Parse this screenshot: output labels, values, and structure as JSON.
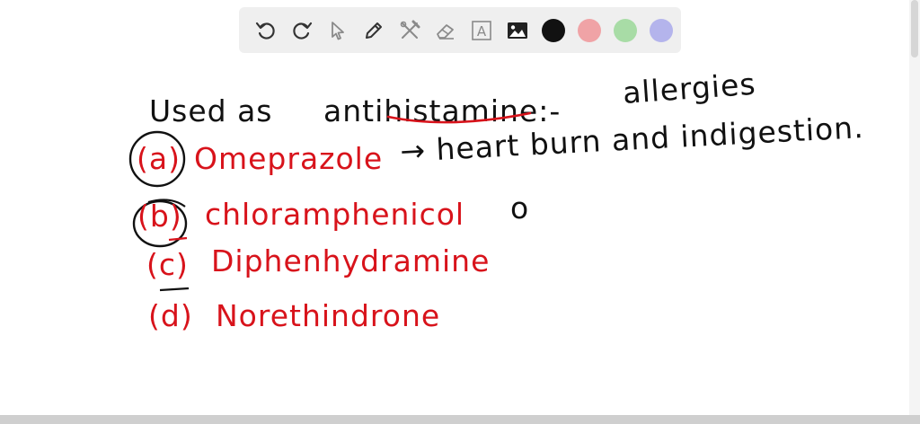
{
  "toolbar": {
    "tools": [
      {
        "name": "undo-icon"
      },
      {
        "name": "redo-icon"
      },
      {
        "name": "pointer-icon"
      },
      {
        "name": "pen-icon"
      },
      {
        "name": "tools-icon"
      },
      {
        "name": "eraser-icon"
      },
      {
        "name": "text-icon",
        "glyph": "A"
      },
      {
        "name": "image-icon"
      }
    ],
    "colors": [
      "#111111",
      "#f0a3a6",
      "#a8dca6",
      "#b4b4ec"
    ]
  },
  "board": {
    "line1": {
      "prefix": "Used as",
      "keyword": "antihistamine:-",
      "note": "allergies"
    },
    "options": [
      {
        "label": "(a)",
        "text": "Omeprazole",
        "note": "→ heart burn and indigestion."
      },
      {
        "label": "(b)",
        "text": "chloramphenicol",
        "note": "o"
      },
      {
        "label": "(c)",
        "text": "Diphenhydramine",
        "note": ""
      },
      {
        "label": "(d)",
        "text": "Norethindrone",
        "note": ""
      }
    ]
  }
}
